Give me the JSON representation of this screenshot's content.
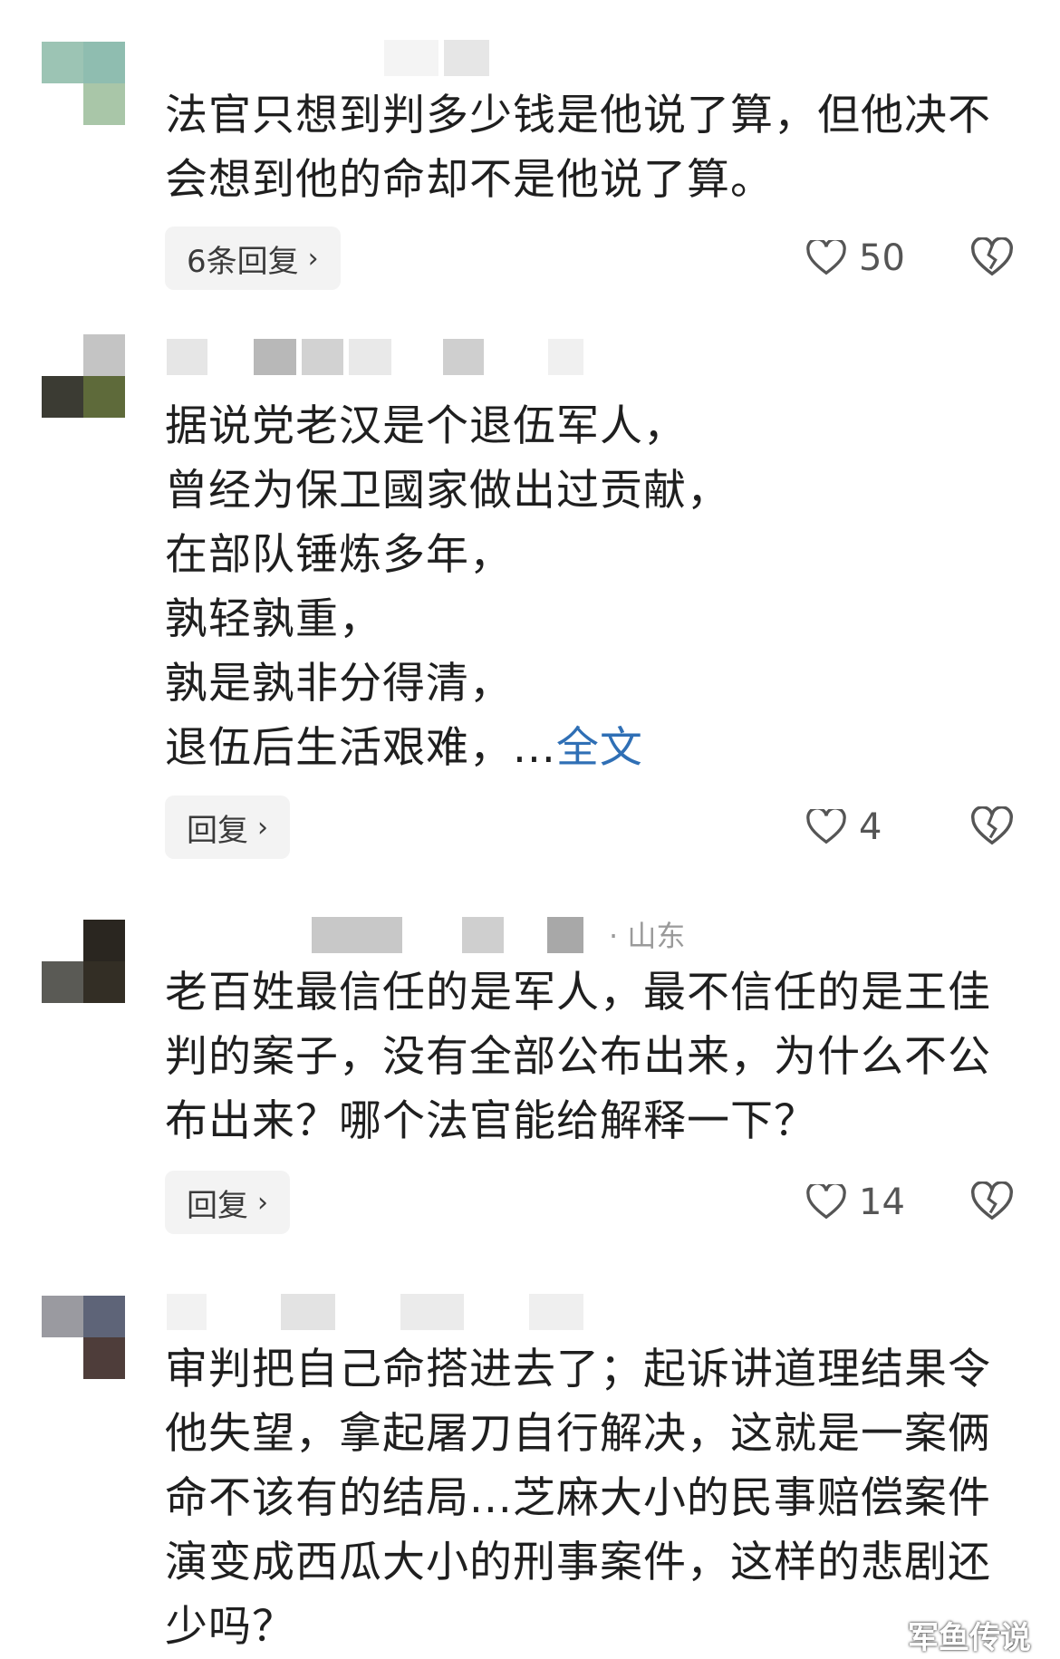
{
  "comments": [
    {
      "text": "法官只想到判多少钱是他说了算，但他决不会想到他的命却不是他说了算。",
      "reply_label": "6条回复",
      "like_count": "50",
      "location": ""
    },
    {
      "text": "据说党老汉是个退伍军人，\n曾经为保卫國家做出过贡献，\n在部队锤炼多年，\n孰轻孰重，\n孰是孰非分得清，\n退伍后生活艰难，",
      "ellipsis": "...",
      "fulltext_label": "全文",
      "reply_label": "回复",
      "like_count": "4",
      "location": ""
    },
    {
      "text": "老百姓最信任的是军人，最不信任的是王佳判的案子，没有全部公布出来，为什么不公布出来？哪个法官能给解释一下？",
      "reply_label": "回复",
      "like_count": "14",
      "location": "· 山东"
    },
    {
      "text": "审判把自己命搭进去了；起诉讲道理结果令他失望，拿起屠刀自行解决，这就是一案俩命不该有的结局...芝麻大小的民事赔偿案件演变成西瓜大小的刑事案件，这样的悲剧还少吗？",
      "location": ""
    }
  ],
  "icons": {
    "like": "heart-outline-icon",
    "dislike": "broken-heart-icon",
    "chevron": "chevron-right-icon"
  },
  "colors": {
    "link": "#2f6fb5",
    "reply_bg": "#f3f3f3",
    "meta": "#9a9a9a"
  },
  "watermark": "军鱼传说"
}
